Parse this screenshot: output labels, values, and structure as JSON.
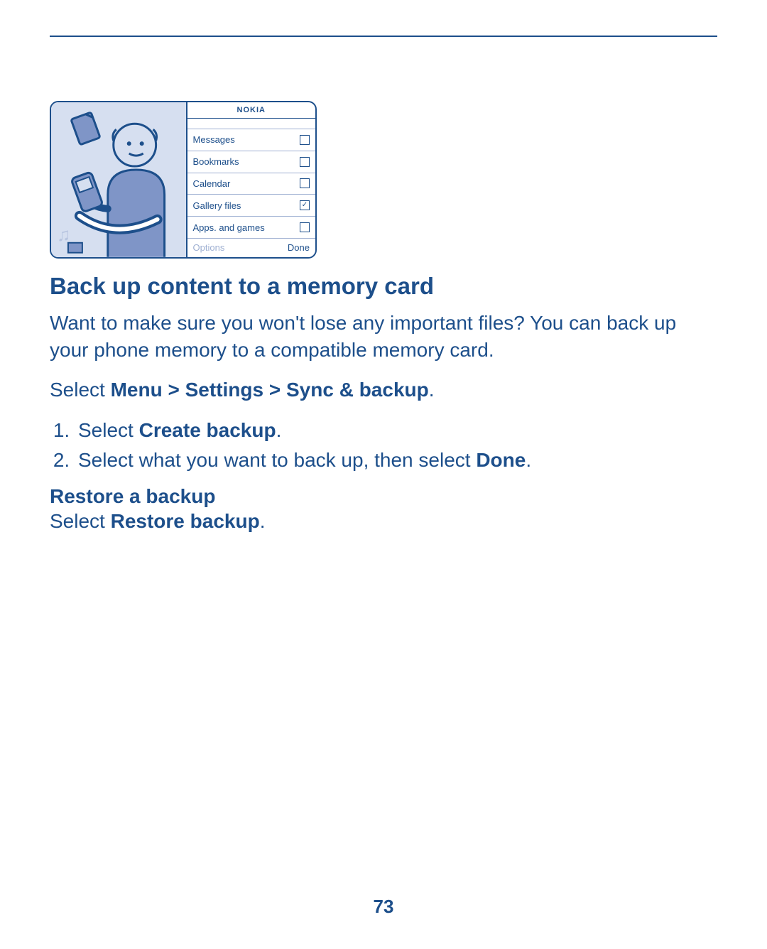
{
  "page_number": "73",
  "illustration": {
    "brand": "NOKIA",
    "items": [
      {
        "label": "Messages",
        "checked": false
      },
      {
        "label": "Bookmarks",
        "checked": false
      },
      {
        "label": "Calendar",
        "checked": false
      },
      {
        "label": "Gallery files",
        "checked": true
      },
      {
        "label": "Apps. and games",
        "checked": false
      }
    ],
    "soft_left": "Options",
    "soft_right": "Done"
  },
  "heading": "Back up content to a memory card",
  "intro": "Want to make sure you won't lose any important files? You can back up your phone memory to a compatible memory card.",
  "nav_prefix": "Select ",
  "nav_path": "Menu > Settings > Sync & backup",
  "nav_suffix": ".",
  "step1_prefix": "Select ",
  "step1_bold": "Create backup",
  "step1_suffix": ".",
  "step2_prefix": "Select what you want to back up, then select ",
  "step2_bold": "Done",
  "step2_suffix": ".",
  "restore_heading": "Restore a backup",
  "restore_prefix": "Select ",
  "restore_bold": "Restore backup",
  "restore_suffix": "."
}
